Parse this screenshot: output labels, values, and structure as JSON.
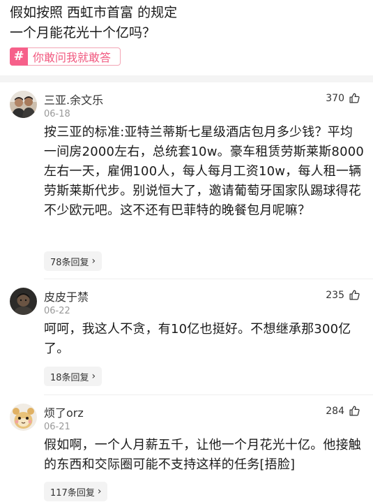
{
  "post": {
    "title_line1": "假如按照 西虹市首富 的规定",
    "title_line2": "一个月能花光十个亿吗？",
    "tag_icon": "#",
    "tag_label": "你敢问我就敢答",
    "accent_color": "#f6608a"
  },
  "comments": [
    {
      "author": "三亚.余文乐",
      "date": "06-18",
      "likes": "370",
      "text": "按三亚的标准:亚特兰蒂斯七星级酒店包月多少钱？平均一间房2000左右，总统套10w。豪车租赁劳斯莱斯8000左右一天，雇佣100人，每人每月工资10w，每人租一辆劳斯莱斯代步。别说恒大了，邀请葡萄牙国家队踢球得花不少欧元吧。这不还有巴菲特的晚餐包月呢嘛？",
      "replies": "78条回复",
      "avatar_icon": "two-men-photo-avatar"
    },
    {
      "author": "皮皮于禁",
      "date": "06-22",
      "likes": "235",
      "text": "呵呵，我这人不贪，有10亿也挺好。不想继承那300亿了。",
      "replies": "18条回复",
      "avatar_icon": "dark-portrait-avatar"
    },
    {
      "author": "烦了orz",
      "date": "06-21",
      "likes": "284",
      "text": "假如啊，一个人月薪五千，让他一个月花光十亿。他接触的东西和交际圈可能不支持这样的任务[捂脸]",
      "replies": "117条回复",
      "avatar_icon": "plush-toy-avatar"
    }
  ]
}
